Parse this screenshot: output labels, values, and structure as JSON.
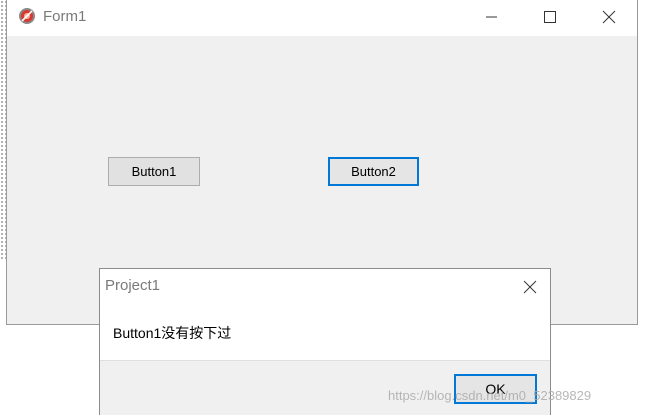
{
  "form": {
    "title": "Form1",
    "icon": "delphi-app-icon",
    "controls": [
      "minimize-icon",
      "maximize-icon",
      "close-icon"
    ],
    "button1_label": "Button1",
    "button2_label": "Button2"
  },
  "dialog": {
    "title": "Project1",
    "message": "Button1没有按下过",
    "ok_label": "OK"
  },
  "watermark": "https://blog.csdn.net/m0_52389829",
  "colors": {
    "focus_border": "#0078d7",
    "window_bg": "#f0f0f0",
    "titlebar_bg": "#ffffff"
  }
}
